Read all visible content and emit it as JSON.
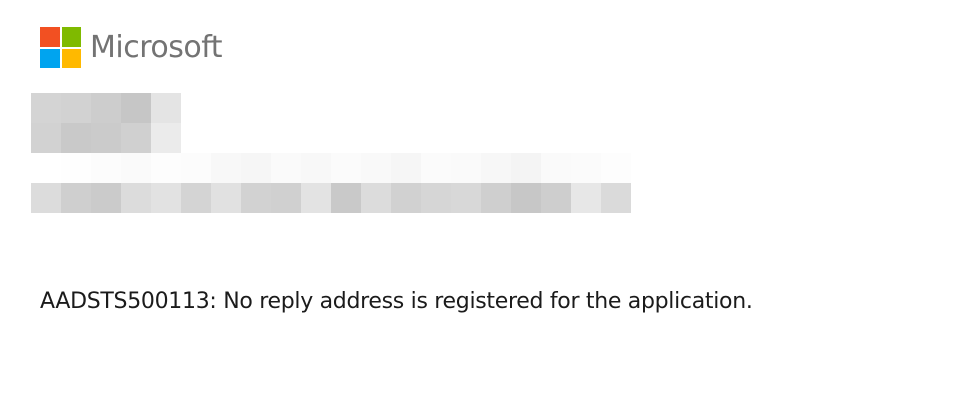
{
  "brand": {
    "name": "Microsoft",
    "logo_icon": "microsoft-four-squares-icon",
    "colors": {
      "red": "#f25022",
      "green": "#7fba00",
      "blue": "#00a4ef",
      "yellow": "#ffb900",
      "text": "#737373"
    }
  },
  "redacted": {
    "block_1_colors": [
      "#d4d4d4",
      "#d2d2d2",
      "#cdcdcd",
      "#c6c6c6",
      "#e4e4e4",
      "#d2d2d2",
      "#c9c9c9",
      "#cbcbcb",
      "#d0d0d0",
      "#ebebeb"
    ],
    "block_2_colors": [
      "#ffffff",
      "#fefefe",
      "#fcfcfc",
      "#fafafa",
      "#fdfdfd",
      "#fcfcfc",
      "#f8f8f8",
      "#f6f6f6",
      "#fafafa",
      "#f8f8f8",
      "#fbfbfb",
      "#f9f9f9",
      "#f6f6f6",
      "#fbfbfb",
      "#fafafa",
      "#f7f7f7",
      "#f4f4f4",
      "#fafafa",
      "#fbfbfb",
      "#fdfdfd",
      "#dcdcdc",
      "#cfcfcf",
      "#cbcbcb",
      "#dcdcdc",
      "#e2e2e2",
      "#d4d4d4",
      "#e1e1e1",
      "#d2d2d2",
      "#d0d0d0",
      "#e3e3e3",
      "#c9c9c9",
      "#dcdcdc",
      "#d1d1d1",
      "#d6d6d6",
      "#d8d8d8",
      "#cfcfcf",
      "#c7c7c7",
      "#cecece",
      "#e7e7e7",
      "#dadada"
    ]
  },
  "error": {
    "message": "AADSTS500113: No reply address is registered for the application."
  }
}
